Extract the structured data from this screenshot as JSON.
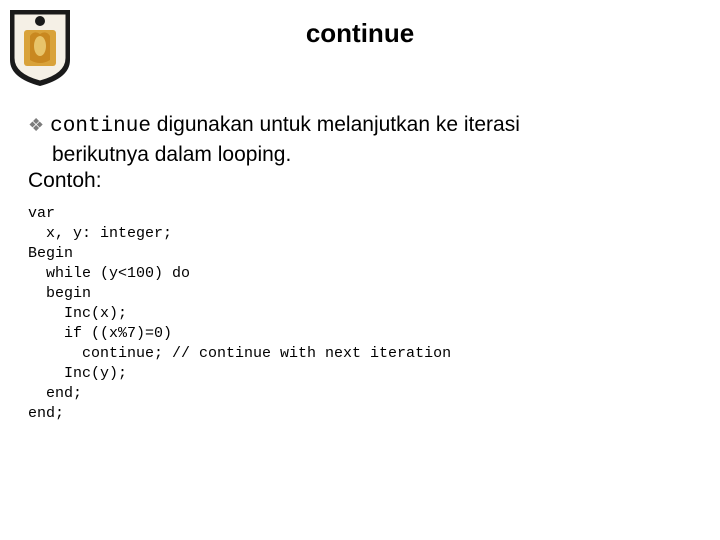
{
  "title": "continue",
  "bullet": {
    "glyph": "❖",
    "keyword": "continue",
    "text_after": " digunakan untuk melanjutkan ke iterasi",
    "line2": "berikutnya dalam looping.",
    "line3": "Contoh:"
  },
  "code": "var\n  x, y: integer;\nBegin\n  while (y<100) do\n  begin\n    Inc(x);\n    if ((x%7)=0)\n      continue; // continue with next iteration\n    Inc(y);\n  end;\nend;"
}
